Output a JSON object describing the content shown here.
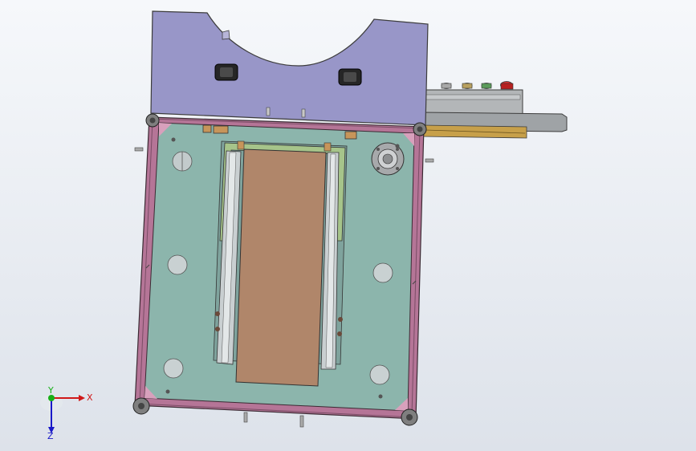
{
  "viewport": {
    "background_top": "#f6f8fb",
    "background_bottom": "#dde2ea"
  },
  "colors": {
    "cover_fill": "#9896c8",
    "frame_pink": "#b57597",
    "plate_teal": "#8cb5ac",
    "pad_brown": "#b0866a",
    "rail_grey": "#c9cfd1",
    "gasket_green": "#a6c48a",
    "control_box_grey": "#b3b6b8",
    "emergency_red": "#d83030",
    "axis_x": "#d01818",
    "axis_y": "#18b018",
    "axis_z": "#1818c8"
  },
  "model": {
    "icons": [
      "cover-plate",
      "handle-icon",
      "control-box",
      "push-button-icon",
      "emergency-stop-icon",
      "frame",
      "corner-caster-icon",
      "base-plate",
      "bearing-flange-icon",
      "hole-icon",
      "conveyor-belt"
    ]
  },
  "triad": {
    "x_label": "X",
    "y_label": "Y",
    "z_label": "Z"
  }
}
